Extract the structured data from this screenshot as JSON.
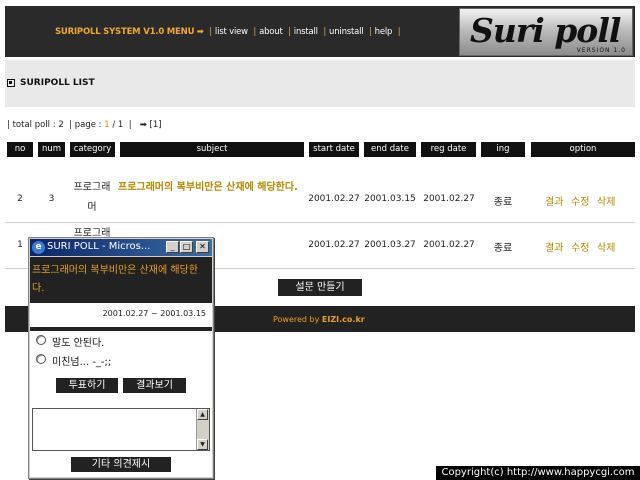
{
  "menu": {
    "system_label": "SURIPOLL SYSTEM V1.0 MENU",
    "arrow": "➡",
    "items": [
      "list view",
      "about",
      "install",
      "uninstall",
      "help"
    ]
  },
  "logo": {
    "text": "Suri poll",
    "version": "VERSION 1.0"
  },
  "section": {
    "title": "SURIPOLL LIST"
  },
  "info": {
    "total_label": "total poll :",
    "total_value": "2",
    "page_label": "page :",
    "page_current": "1",
    "page_total": "1",
    "page_link": "➡ [1]"
  },
  "table": {
    "headers": [
      "no",
      "num",
      "category",
      "subject",
      "start date",
      "end date",
      "reg date",
      "ing",
      "option"
    ],
    "rows": [
      {
        "no": "2",
        "num": "3",
        "category": "프로그래머",
        "subject": "프로그래머의 복부비만은 산재에 해당한다.",
        "start": "2001.02.27",
        "end": "2001.03.15",
        "reg": "2001.02.27",
        "ing": "종료",
        "options": [
          "결과",
          "수정",
          "삭제"
        ]
      },
      {
        "no": "1",
        "num": "",
        "category": "프로그래",
        "subject": "",
        "start": "2001.02.27",
        "end": "2001.03.27",
        "reg": "2001.02.27",
        "ing": "종료",
        "options": [
          "결과",
          "수정",
          "삭제"
        ]
      }
    ]
  },
  "make_poll_button": "설문 만들기",
  "footer": {
    "powered_prefix": "Powered by ",
    "powered_site": "EIZI.co.kr"
  },
  "popup": {
    "title": "SURI POLL - Micros...",
    "question": "프로그래머의 복부비만은 산재에 해당한다.",
    "dates": "2001.02.27 ~ 2001.03.15",
    "options": [
      "말도 안된다.",
      "미친넘... -_-;;"
    ],
    "vote_button": "투표하기",
    "result_button": "결과보기",
    "etc_button": "기타 의견제시"
  },
  "copyright": "Copyright(c) http://www.happycgi.com",
  "colors": {
    "accent": "#e8a020",
    "dark": "#222222",
    "subject": "#b38a00"
  }
}
